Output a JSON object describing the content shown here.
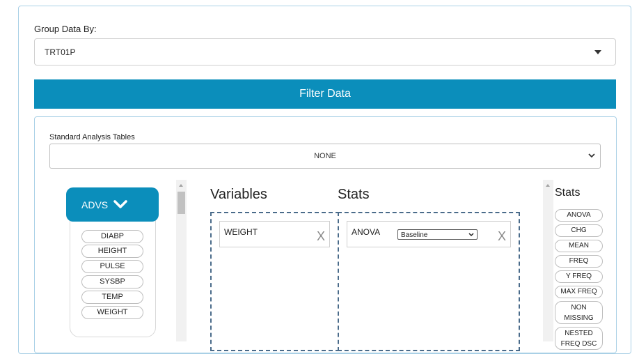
{
  "group": {
    "label": "Group Data By:",
    "value": "TRT01P"
  },
  "filter_button": "Filter Data",
  "analysis": {
    "label": "Standard Analysis Tables",
    "value": "NONE"
  },
  "dataset": {
    "name": "ADVS",
    "variables": [
      "DIABP",
      "HEIGHT",
      "PULSE",
      "SYSBP",
      "TEMP",
      "WEIGHT"
    ]
  },
  "variables_panel": {
    "title": "Variables",
    "items": [
      {
        "name": "WEIGHT",
        "remove": "X"
      }
    ]
  },
  "stats_panel": {
    "title": "Stats",
    "items": [
      {
        "name": "ANOVA",
        "option": "Baseline",
        "remove": "X"
      }
    ]
  },
  "stats_list": {
    "title": "Stats",
    "items": [
      "ANOVA",
      "CHG",
      "MEAN",
      "FREQ",
      "Y FREQ",
      "MAX FREQ",
      "NON MISSING",
      "NESTED FREQ DSC"
    ]
  },
  "colors": {
    "accent": "#0b8ebb",
    "card_border": "#a9d0e6",
    "dropzone_border": "#4a6b8a"
  }
}
